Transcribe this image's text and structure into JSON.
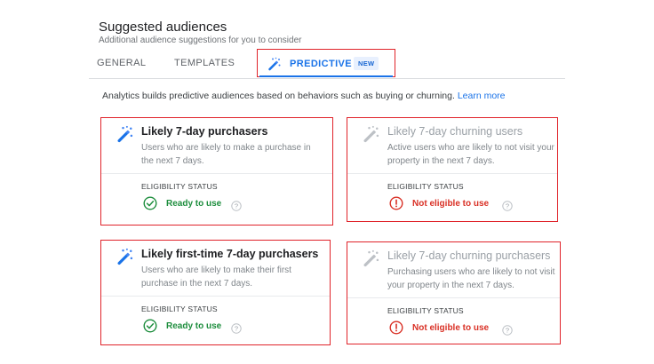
{
  "header": {
    "title": "Suggested audiences",
    "subtitle": "Additional audience suggestions for you to consider"
  },
  "tabs": [
    {
      "label": "GENERAL"
    },
    {
      "label": "TEMPLATES"
    },
    {
      "label": "PREDICTIVE",
      "badge": "NEW",
      "active": true,
      "icon": "magic-wand-icon"
    }
  ],
  "intro": {
    "text": "Analytics builds predictive audiences based on behaviors such as buying or churning.",
    "link": "Learn more"
  },
  "cards": [
    {
      "title": "Likely 7-day purchasers",
      "description": "Users who are likely to make a purchase in the next 7 days.",
      "eligibility_label": "ELIGIBILITY STATUS",
      "status": "Ready to use",
      "status_type": "ready",
      "enabled": true
    },
    {
      "title": "Likely 7-day churning users",
      "description": "Active users who are likely to not visit your property in the next 7 days.",
      "eligibility_label": "ELIGIBILITY STATUS",
      "status": "Not eligible to use",
      "status_type": "not-eligible",
      "enabled": false
    },
    {
      "title": "Likely first-time 7-day purchasers",
      "description": "Users who are likely to make their first purchase in the next 7 days.",
      "eligibility_label": "ELIGIBILITY STATUS",
      "status": "Ready to use",
      "status_type": "ready",
      "enabled": true
    },
    {
      "title": "Likely 7-day churning purchasers",
      "description": "Purchasing users who are likely to not visit your property in the next 7 days.",
      "eligibility_label": "ELIGIBILITY STATUS",
      "status": "Not eligible to use",
      "status_type": "not-eligible",
      "enabled": false
    }
  ],
  "colors": {
    "accent": "#1a73e8",
    "ready": "#1e8e3e",
    "not_eligible": "#d93025",
    "highlight_border": "#e0232a"
  }
}
